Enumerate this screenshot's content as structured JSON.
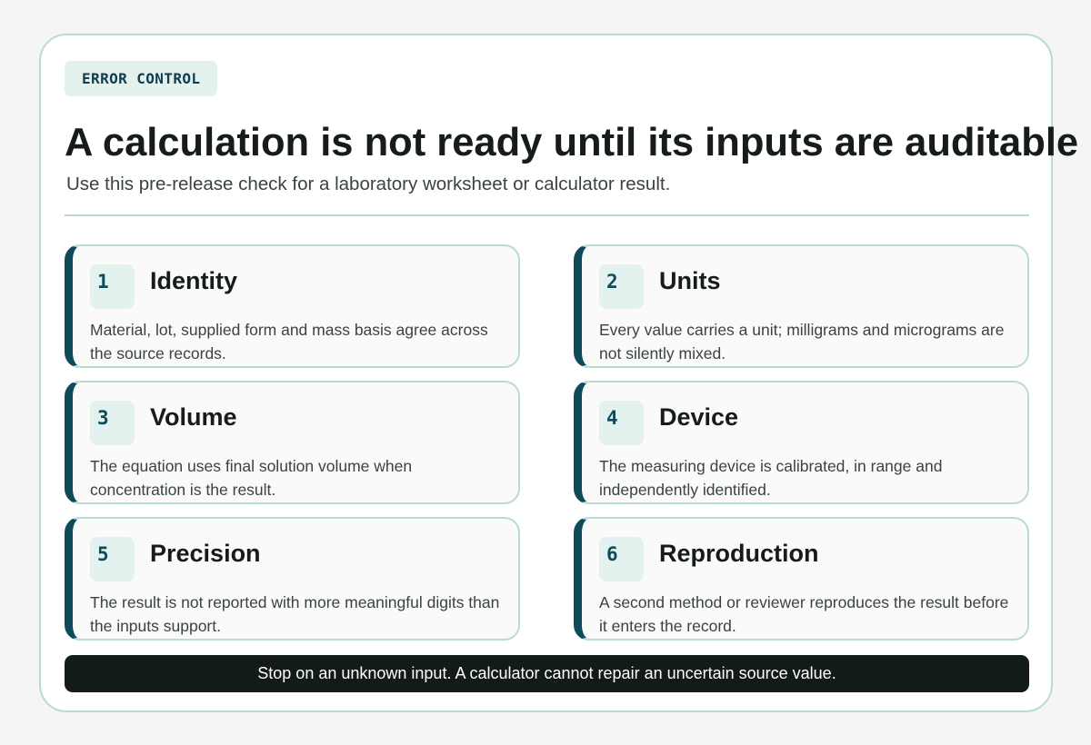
{
  "header": {
    "kicker": "ERROR CONTROL",
    "title": "A calculation is not ready until its inputs are auditable",
    "subtitle": "Use this pre-release check for a laboratory worksheet or calculator result."
  },
  "checks": [
    {
      "number": "1",
      "title": "Identity",
      "description": "Material, lot, supplied form and mass basis agree across the source records."
    },
    {
      "number": "2",
      "title": "Units",
      "description": "Every value carries a unit; milligrams and micrograms are not silently mixed."
    },
    {
      "number": "3",
      "title": "Volume",
      "description": "The equation uses final solution volume when concentration is the result."
    },
    {
      "number": "4",
      "title": "Device",
      "description": "The measuring device is calibrated, in range and independently identified."
    },
    {
      "number": "5",
      "title": "Precision",
      "description": "The result is not reported with more meaningful digits than the inputs support."
    },
    {
      "number": "6",
      "title": "Reproduction",
      "description": "A second method or reviewer reproduces the result before it enters the record."
    }
  ],
  "footer": {
    "text": "Stop on an unknown input. A calculator cannot repair an uncertain source value."
  },
  "colors": {
    "accent": "#0f4a5a",
    "border": "#b9dbd4",
    "tint": "#e4f2ef",
    "footer_bg": "#131a1a"
  }
}
